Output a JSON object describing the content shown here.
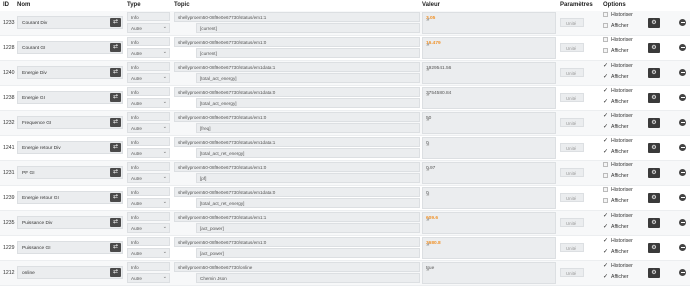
{
  "headers": {
    "id": "ID",
    "name": "Nom",
    "type": "Type",
    "topic": "Topic",
    "value": "Valeur",
    "params": "Paramètres",
    "options": "Options"
  },
  "rows": [
    {
      "id": "1233",
      "name": "Courant Div",
      "type": "Info",
      "subtype": "Autre",
      "topic": "shellyproem50-08f9e0e67730/status/em1:1",
      "subtopic": "[current]",
      "value": "3.05",
      "hot": true,
      "unit": "Unité",
      "historize": false,
      "display": false,
      "chk": "box"
    },
    {
      "id": "1228",
      "name": "Courant GI",
      "type": "Info",
      "subtype": "Autre",
      "topic": "shellyproem50-08f9e0e67730/status/em1:0",
      "subtopic": "[current]",
      "value": "16.479",
      "hot": true,
      "unit": "Unité",
      "historize": false,
      "display": false,
      "chk": "box"
    },
    {
      "id": "1240",
      "name": "Energie Div",
      "type": "Info",
      "subtype": "Autre",
      "topic": "shellyproem50-08f9e0e67730/status/em1data:1",
      "subtopic": "[total_act_energy]",
      "value": "1929541.56",
      "hot": false,
      "unit": "Unité",
      "chk": "tick"
    },
    {
      "id": "1238",
      "name": "Energie GI",
      "type": "Info",
      "subtype": "Autre",
      "topic": "shellyproem50-08f9e0e67730/status/em1data:0",
      "subtopic": "[total_act_energy]",
      "value": "3754580.84",
      "hot": false,
      "unit": "Unité",
      "chk": "tick"
    },
    {
      "id": "1232",
      "name": "Frequence GI",
      "type": "Info",
      "subtype": "Autre",
      "topic": "shellyproem50-08f9e0e67730/status/em1:0",
      "subtopic": "[freq]",
      "value": "50",
      "hot": false,
      "unit": "Unité",
      "chk": "tick"
    },
    {
      "id": "1241",
      "name": "Energie retour Div",
      "type": "Info",
      "subtype": "Autre",
      "topic": "shellyproem50-08f9e0e67730/status/em1data:1",
      "subtopic": "[total_act_ret_energy]",
      "value": "0",
      "hot": false,
      "unit": "Unité",
      "chk": "tick"
    },
    {
      "id": "1231",
      "name": "PF GI",
      "type": "Info",
      "subtype": "Autre",
      "topic": "shellyproem50-08f9e0e67730/status/em1:0",
      "subtopic": "[pf]",
      "value": "0.97",
      "hot": false,
      "unit": "Unité",
      "chk": "box"
    },
    {
      "id": "1239",
      "name": "Energie retour GI",
      "type": "Info",
      "subtype": "Autre",
      "topic": "shellyproem50-08f9e0e67730/status/em1data:0",
      "subtopic": "[total_act_ret_energy]",
      "value": "0",
      "hot": false,
      "unit": "Unité",
      "chk": "box"
    },
    {
      "id": "1235",
      "name": "Puissance Div",
      "type": "Info",
      "subtype": "Autre",
      "topic": "shellyproem50-08f9e0e67730/status/em1:1",
      "subtopic": "[act_power]",
      "value": "609.6",
      "hot": true,
      "unit": "Unité",
      "chk": "tick"
    },
    {
      "id": "1229",
      "name": "Puissance GI",
      "type": "Info",
      "subtype": "Autre",
      "topic": "shellyproem50-08f9e0e67730/status/em1:0",
      "subtopic": "[act_power]",
      "value": "3680.8",
      "hot": true,
      "unit": "Unité",
      "chk": "tick"
    },
    {
      "id": "1212",
      "name": "online",
      "type": "Info",
      "subtype": "Autre",
      "topic": "shellyproem50-08f9e0e67730/online",
      "subtopic": "Chemin Json",
      "value": "true",
      "hot": false,
      "unit": "Unité",
      "chk": "tick"
    }
  ],
  "options": {
    "historize": "Historiser",
    "display": "Afficher"
  },
  "icons": {
    "name_button": "wrench-icon",
    "config": "gears-icon",
    "delete": "minus-circle-icon",
    "chevron": "chevron-down-icon"
  }
}
